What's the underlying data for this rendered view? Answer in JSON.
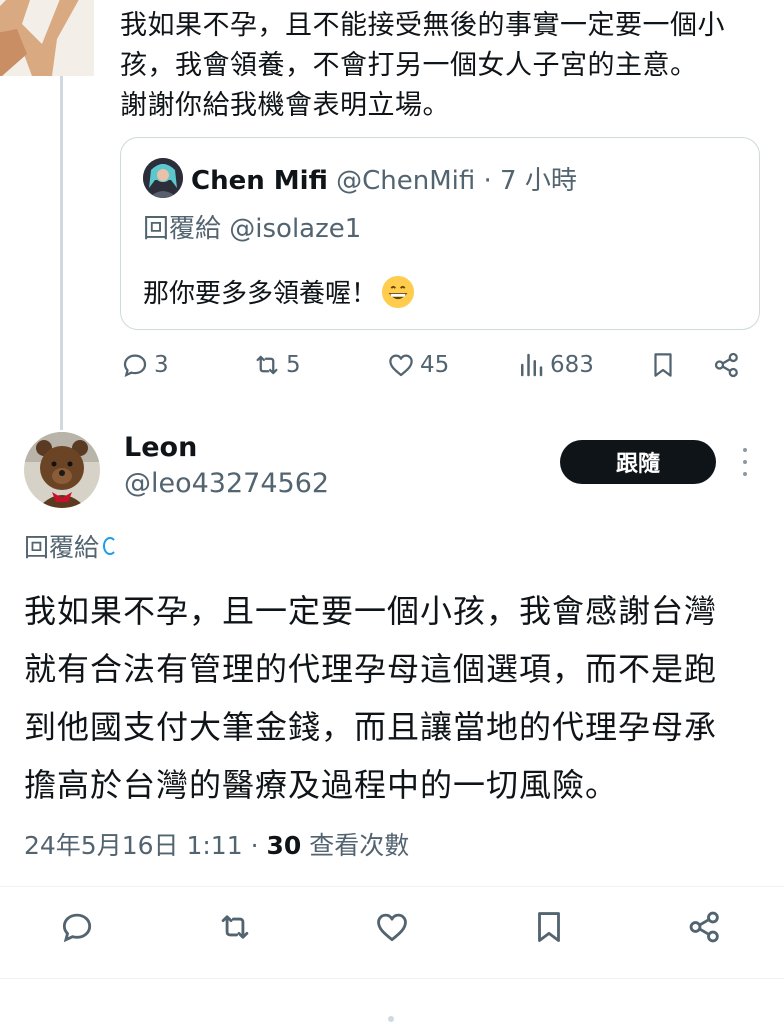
{
  "previous_tweet": {
    "text_lines": [
      "我如果不孕，且不能接受無後的事實一定要一個小",
      "孩，我會領養，不會打另一個女人子宮的主意。",
      "謝謝你給我機會表明立場。"
    ],
    "quote": {
      "name": "Chen Mifi",
      "handle": "@ChenMifi",
      "separator": " · ",
      "time": "7 小時",
      "reply_to": "回覆給 @isolaze1",
      "text": "那你要多多領養喔！"
    },
    "actions": {
      "replies": "3",
      "retweets": "5",
      "likes": "45",
      "views": "683"
    }
  },
  "main_tweet": {
    "name": "Leon",
    "handle": "@leo43274562",
    "follow_label": "跟隨",
    "reply_to_label": "回覆給",
    "text_lines": [
      "我如果不孕，且一定要一個小孩，我會感謝台灣",
      "就有合法有管理的代理孕母這個選項，而不是跑",
      "到他國支付大筆金錢，而且讓當地的代理孕母承",
      "擔高於台灣的醫療及過程中的一切風險。"
    ],
    "timestamp": "24年5月16日 1:11",
    "separator": " · ",
    "view_count": "30",
    "view_label": "查看次數"
  },
  "icons": {
    "reply": "reply-icon",
    "retweet": "retweet-icon",
    "like": "heart-icon",
    "views": "views-icon",
    "bookmark": "bookmark-icon",
    "share": "share-icon",
    "more": "more-vertical-icon"
  },
  "colors": {
    "text": "#0f1419",
    "secondary": "#536471",
    "border": "#cfd9de",
    "follow_bg": "#0f1419",
    "accent": "#1d9bf0"
  }
}
